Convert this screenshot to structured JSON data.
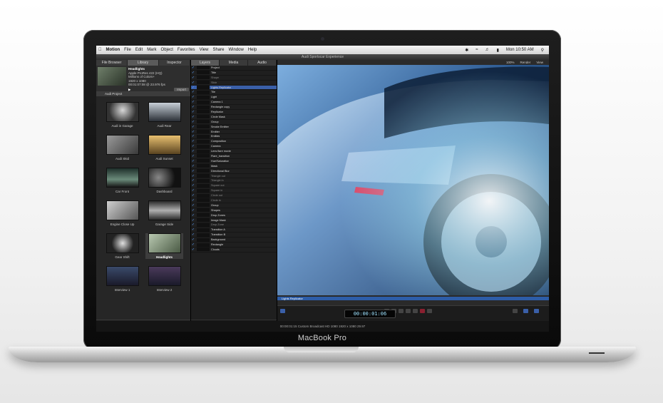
{
  "device": {
    "model_label": "MacBook Pro"
  },
  "menubar": {
    "app_name": "Motion",
    "items": [
      "File",
      "Edit",
      "Mark",
      "Object",
      "Favorites",
      "View",
      "Share",
      "Window",
      "Help"
    ],
    "clock": "Mon 10:50 AM"
  },
  "window": {
    "title": "Audi Sportscar Experience"
  },
  "browser": {
    "tabs": [
      "File Browser",
      "Library",
      "Inspector"
    ],
    "preview": {
      "name": "Headlights",
      "lines": [
        "Apple ProRes 422 (HQ)",
        "Millions of Colors+",
        "1920 x 1080",
        "00:01:07:08 @ 23.976 fps"
      ],
      "import_label": "Import"
    },
    "path": "Audi Project",
    "clips": [
      {
        "label": "Audi in Garage"
      },
      {
        "label": "Audi Rear"
      },
      {
        "label": "Audi Skid"
      },
      {
        "label": "Audi Sunset"
      },
      {
        "label": "Car Front"
      },
      {
        "label": "Dashboard"
      },
      {
        "label": "Engine Close Up"
      },
      {
        "label": "Garage Side"
      },
      {
        "label": "Gear Shift"
      },
      {
        "label": "Headlights",
        "selected": true
      },
      {
        "label": "Interview 1"
      },
      {
        "label": "Interview 2"
      }
    ]
  },
  "layers": {
    "tabs": [
      "Layers",
      "Media",
      "Audio"
    ],
    "rows": [
      {
        "name": "Project"
      },
      {
        "name": "Title"
      },
      {
        "name": "Shape",
        "dim": true
      },
      {
        "name": "Slide",
        "dim": true
      },
      {
        "name": "Lights Replicator",
        "selected": true
      },
      {
        "name": "Tile"
      },
      {
        "name": "Light"
      },
      {
        "name": "Camera 1"
      },
      {
        "name": "Rectangle copy"
      },
      {
        "name": "Replicator"
      },
      {
        "name": "Circle Mask"
      },
      {
        "name": "Group"
      },
      {
        "name": "Smoke Emitter"
      },
      {
        "name": "Emitter"
      },
      {
        "name": "Entities"
      },
      {
        "name": "Composition"
      },
      {
        "name": "Camera"
      },
      {
        "name": "Lens flare movie"
      },
      {
        "name": "Flare_transition"
      },
      {
        "name": "Hue/Saturation"
      },
      {
        "name": "Mask"
      },
      {
        "name": "Directional Blur"
      },
      {
        "name": "Triangle out",
        "dim": true
      },
      {
        "name": "Triangle in",
        "dim": true
      },
      {
        "name": "Square out",
        "dim": true
      },
      {
        "name": "Square in",
        "dim": true
      },
      {
        "name": "Circle out",
        "dim": true
      },
      {
        "name": "Circle in",
        "dim": true
      },
      {
        "name": "Group"
      },
      {
        "name": "Shapes"
      },
      {
        "name": "Drop Zones"
      },
      {
        "name": "Image Mask"
      },
      {
        "name": "Drop Zone",
        "dim": true
      },
      {
        "name": "Transition A"
      },
      {
        "name": "Transition B"
      },
      {
        "name": "Background"
      },
      {
        "name": "Rectangle"
      },
      {
        "name": "Clouds"
      }
    ]
  },
  "canvas": {
    "zoom": "100%",
    "render_label": "Render",
    "view_label": "View"
  },
  "timeline": {
    "track_label": "Lights Replicator",
    "timecode": "00:00:01:06"
  },
  "status": {
    "text": "00:00:01:15  Custom Broadcast HD 1080  1920 x 1080  29.97"
  },
  "colors": {
    "selection": "#3a5fa8",
    "timecode": "#9fe3ff"
  }
}
